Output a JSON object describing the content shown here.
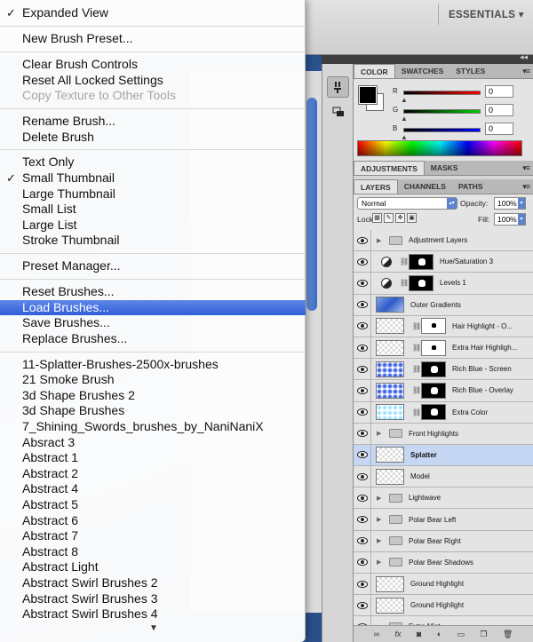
{
  "workspace": {
    "label": "ESSENTIALS ▾"
  },
  "menu": {
    "items": [
      {
        "label": "Expanded View",
        "checked": true
      },
      {
        "label": "New Brush Preset..."
      },
      {
        "label": "Clear Brush Controls"
      },
      {
        "label": "Reset All Locked Settings"
      },
      {
        "label": "Copy Texture to Other Tools",
        "disabled": true
      },
      {
        "label": "Rename Brush..."
      },
      {
        "label": "Delete Brush"
      },
      {
        "label": "Text Only"
      },
      {
        "label": "Small Thumbnail",
        "checked": true
      },
      {
        "label": "Large Thumbnail"
      },
      {
        "label": "Small List"
      },
      {
        "label": "Large List"
      },
      {
        "label": "Stroke Thumbnail"
      },
      {
        "label": "Preset Manager..."
      },
      {
        "label": "Reset Brushes..."
      },
      {
        "label": "Load Brushes...",
        "highlighted": true
      },
      {
        "label": "Save Brushes..."
      },
      {
        "label": "Replace Brushes..."
      },
      {
        "label": "11-Splatter-Brushes-2500x-brushes"
      },
      {
        "label": "21 Smoke Brush"
      },
      {
        "label": "3d Shape Brushes 2"
      },
      {
        "label": "3d Shape Brushes"
      },
      {
        "label": "7_Shining_Swords_brushes_by_NaniNaniX"
      },
      {
        "label": "Absract 3"
      },
      {
        "label": "Abstract 1"
      },
      {
        "label": "Abstract 2"
      },
      {
        "label": "Abstract 4"
      },
      {
        "label": "Abstract 5"
      },
      {
        "label": "Abstract 6"
      },
      {
        "label": "Abstract 7"
      },
      {
        "label": "Abstract 8"
      },
      {
        "label": "Abstract Light"
      },
      {
        "label": "Abstract Swirl Brushes 2"
      },
      {
        "label": "Abstract Swirl Brushes 3"
      },
      {
        "label": "Abstract Swirl Brushes 4"
      }
    ],
    "check_glyph": "✓",
    "scroll_arrow": "▼"
  },
  "color_panel": {
    "tabs": [
      "COLOR",
      "SWATCHES",
      "STYLES"
    ],
    "channels": [
      {
        "label": "R",
        "value": "0"
      },
      {
        "label": "G",
        "value": "0"
      },
      {
        "label": "B",
        "value": "0"
      }
    ],
    "foreground": "#000000",
    "background": "#ffffff"
  },
  "adjustments_panel": {
    "tabs": [
      "ADJUSTMENTS",
      "MASKS"
    ]
  },
  "layers_panel": {
    "tabs": [
      "LAYERS",
      "CHANNELS",
      "PATHS"
    ],
    "blend_mode": "Normal",
    "opacity_label": "Opacity:",
    "opacity": "100%",
    "lock_label": "Lock:",
    "fill_label": "Fill:",
    "fill": "100%",
    "layers": [
      {
        "name": "Adjustment Layers",
        "kind": "group"
      },
      {
        "name": "Hue/Saturation 3",
        "kind": "adjustment"
      },
      {
        "name": "Levels 1",
        "kind": "adjustment"
      },
      {
        "name": "Outer Gradients",
        "kind": "pixel-blue"
      },
      {
        "name": "Hair Highlight - O...",
        "kind": "masked-white"
      },
      {
        "name": "Extra Hair Highligh...",
        "kind": "masked-white"
      },
      {
        "name": "Rich Blue - Screen",
        "kind": "masked-bluedot"
      },
      {
        "name": "Rich Blue - Overlay",
        "kind": "masked-bluedot"
      },
      {
        "name": "Extra Color",
        "kind": "masked-cyan"
      },
      {
        "name": "Front Highlights",
        "kind": "group"
      },
      {
        "name": "Splatter",
        "kind": "pixel",
        "selected": true
      },
      {
        "name": "Model",
        "kind": "pixel"
      },
      {
        "name": "Lightwave",
        "kind": "group"
      },
      {
        "name": "Polar Bear Left",
        "kind": "group"
      },
      {
        "name": "Polar Bear Right",
        "kind": "group"
      },
      {
        "name": "Polar Bear Shadows",
        "kind": "group"
      },
      {
        "name": "Ground Highlight",
        "kind": "pixel"
      },
      {
        "name": "Ground Highlight",
        "kind": "pixel"
      },
      {
        "name": "Extra Mist",
        "kind": "group"
      }
    ],
    "footer_icons": [
      "link-icon",
      "fx-icon",
      "mask-icon",
      "adjustment-icon",
      "folder-icon",
      "new-layer-icon",
      "trash-icon"
    ]
  }
}
